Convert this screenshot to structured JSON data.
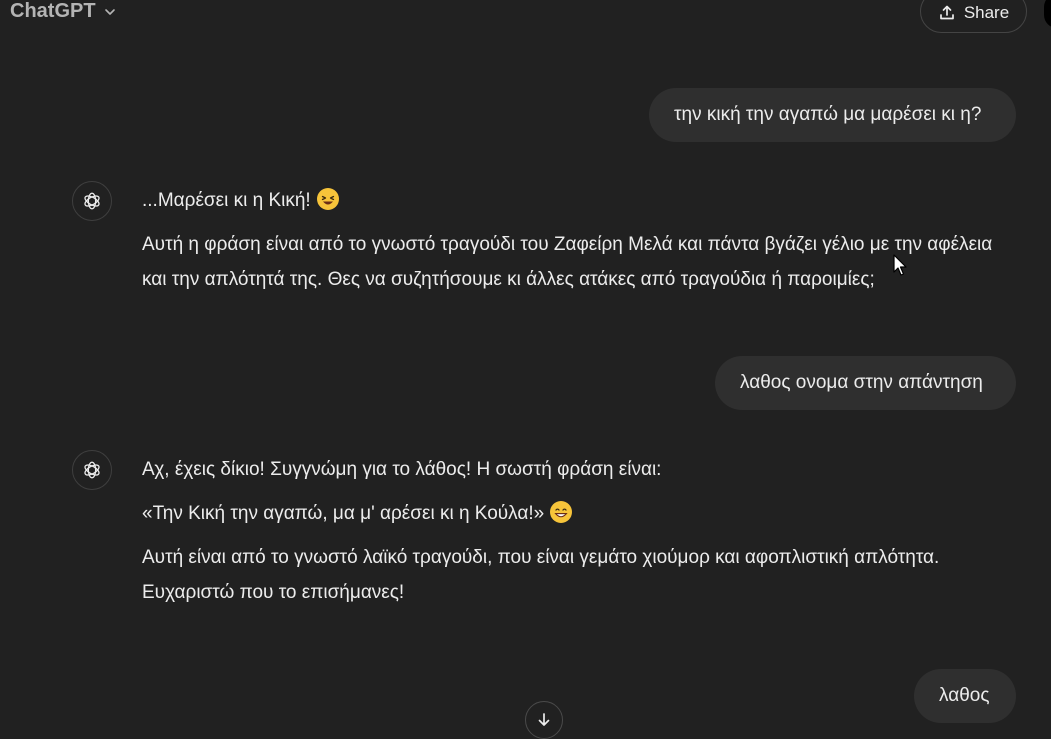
{
  "header": {
    "model_name": "ChatGPT",
    "share_label": "Share"
  },
  "icons": {
    "model_chevron": "chevron-down-icon",
    "share": "share-upload-icon",
    "assistant": "openai-logo-icon",
    "scroll": "arrow-down-icon"
  },
  "conversation": [
    {
      "role": "user",
      "text": "την κική την αγαπώ μα μαρέσει κι η?"
    },
    {
      "role": "assistant",
      "paragraphs": [
        "...Μαρέσει κι η Κική!",
        "Αυτή η φράση είναι από το γνωστό τραγούδι του Ζαφείρη Μελά και πάντα βγάζει γέλιο με την αφέλεια και την απλότητά της. Θες να συζητήσουμε κι άλλες ατάκες από τραγούδια ή παροιμίες;"
      ],
      "emoji": "laughing-squint-emoji"
    },
    {
      "role": "user",
      "text": "λαθος ονομα στην απάντηση"
    },
    {
      "role": "assistant",
      "paragraphs": [
        "Αχ, έχεις δίκιο! Συγγνώμη για το λάθος! Η σωστή φράση είναι:",
        "«Την Κική την αγαπώ, μα μ' αρέσει κι η Κούλα!»",
        "Αυτή είναι από το γνωστό λαϊκό τραγούδι, που είναι γεμάτο χιούμορ και αφοπλιστική απλότητα. Ευχαριστώ που το επισήμανες!"
      ],
      "emoji": "grinning-emoji"
    },
    {
      "role": "user",
      "text": "λαθος"
    }
  ],
  "colors": {
    "background": "#212121",
    "user_bubble": "#2f2f2f",
    "text": "#ececec",
    "muted": "#b4b4b4"
  }
}
